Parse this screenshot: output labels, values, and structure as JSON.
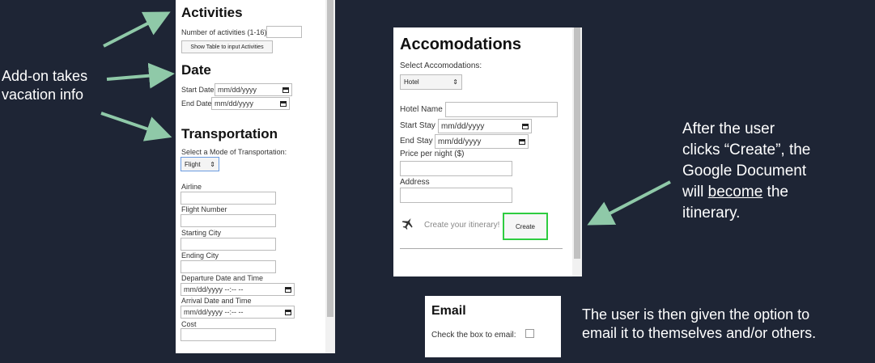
{
  "left_panel": {
    "activities": {
      "title": "Activities",
      "count_label": "Number of activities (1-16):",
      "show_table_button": "Show Table to input Activities"
    },
    "date": {
      "title": "Date",
      "start_label": "Start Date",
      "start_value": "mm/dd/yyyy",
      "end_label": "End Date",
      "end_value": "mm/dd/yyyy"
    },
    "transportation": {
      "title": "Transportation",
      "mode_label": "Select a Mode of Transportation:",
      "mode_value": "Flight",
      "airline_label": "Airline",
      "flight_number_label": "Flight Number",
      "starting_city_label": "Starting City",
      "ending_city_label": "Ending City",
      "departure_label": "Departure Date and Time",
      "departure_value": "mm/dd/yyyy --:-- --",
      "arrival_label": "Arrival Date and Time",
      "arrival_value": "mm/dd/yyyy --:-- --",
      "cost_label": "Cost"
    }
  },
  "accommodations_panel": {
    "title": "Accomodations",
    "select_label": "Select Accomodations:",
    "select_value": "Hotel",
    "hotel_name_label": "Hotel Name",
    "start_stay_label": "Start Stay",
    "start_stay_value": "mm/dd/yyyy",
    "end_stay_label": "End Stay",
    "end_stay_value": "mm/dd/yyyy",
    "price_label": "Price per night ($)",
    "address_label": "Address",
    "create_prompt": "Create your itinerary!",
    "create_button": "Create",
    "icon": "airplane-icon"
  },
  "email_panel": {
    "title": "Email",
    "checkbox_label": "Check the box to email:"
  },
  "annotations": {
    "addon_line1": "Add-on takes",
    "addon_line2": "vacation info",
    "create_line1": "After the user",
    "create_line2": "clicks “Create”, the",
    "create_line3": "Google Document",
    "create_line4_pre": "will ",
    "create_line4_u": "become",
    "create_line4_post": " the",
    "create_line5": "itinerary.",
    "email_line1": "The user is then given the option to",
    "email_line2": "email it to themselves and/or others."
  },
  "colors": {
    "background": "#1e2535",
    "arrow": "#8fc9a8",
    "create_highlight": "#2ecc40"
  }
}
